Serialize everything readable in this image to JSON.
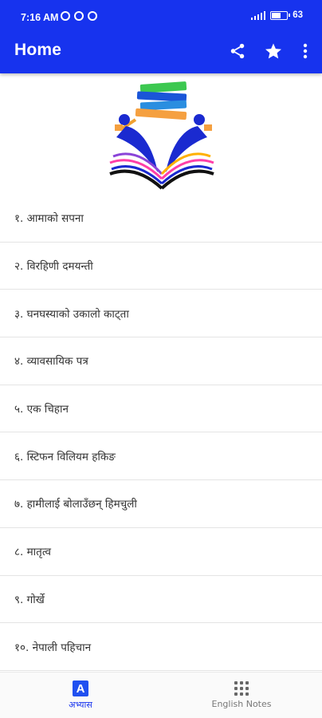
{
  "status_bar": {
    "time": "7:16 AM",
    "battery": "63",
    "battery_level": 0.63
  },
  "toolbar": {
    "title": "Home"
  },
  "icons": {
    "share": "share-icon",
    "star": "star-icon",
    "more": "more-vert-icon",
    "logo": "books-readers-logo"
  },
  "chapters": [
    "१. आमाको सपना",
    "२. विरहिणी दमयन्ती",
    "३. घनघस्याको उकालो काट्ता",
    "४. व्यावसायिक पत्र",
    "५. एक चिहान",
    "६. स्टिफन विलियम हकिङ",
    "७. हामीलाई बोलाउँछन् हिमचुली",
    "८. मातृत्व",
    "९. गोर्खे",
    "१०. नेपाली पहिचान"
  ],
  "bottom_nav": {
    "tab1": {
      "label": "अभ्यास",
      "icon_letter": "A"
    },
    "tab2": {
      "label": "English Notes"
    }
  },
  "colors": {
    "primary": "#1733ee",
    "accent": "#2050f0"
  }
}
